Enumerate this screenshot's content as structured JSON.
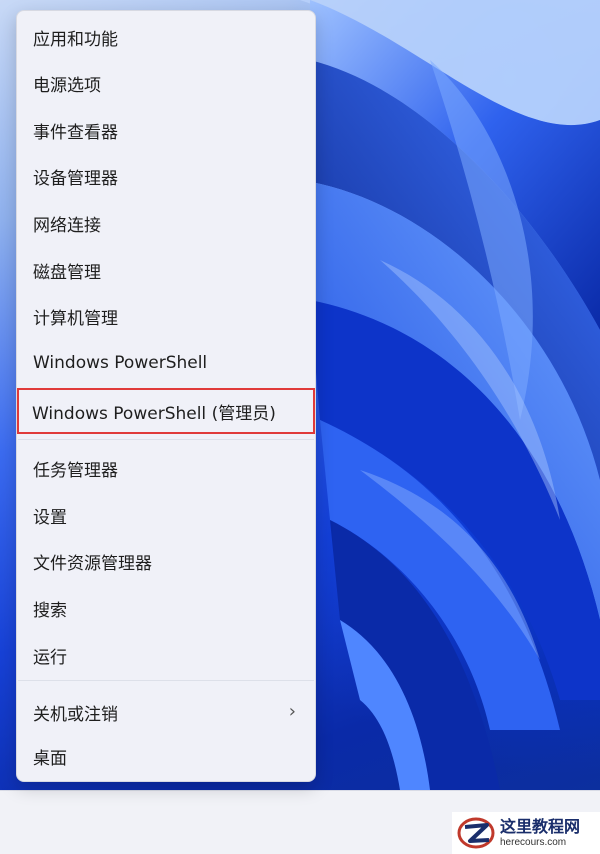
{
  "menu": {
    "items": [
      {
        "label": "应用和功能"
      },
      {
        "label": "电源选项"
      },
      {
        "label": "事件查看器"
      },
      {
        "label": "设备管理器"
      },
      {
        "label": "网络连接"
      },
      {
        "label": "磁盘管理"
      },
      {
        "label": "计算机管理"
      },
      {
        "label": "Windows PowerShell"
      },
      {
        "label": "Windows PowerShell (管理员)",
        "highlighted": true
      },
      {
        "label": "任务管理器"
      },
      {
        "label": "设置"
      },
      {
        "label": "文件资源管理器"
      },
      {
        "label": "搜索"
      },
      {
        "label": "运行"
      },
      {
        "label": "关机或注销",
        "has_submenu": true
      },
      {
        "label": "桌面"
      }
    ],
    "submenu_icon": "chevron-right-icon"
  },
  "watermark": {
    "title": "这里教程网",
    "url": "herecours.com",
    "logo_icon": "z-logo-icon"
  },
  "colors": {
    "highlight_border": "#e03a3a",
    "menu_background": "#f0f1f8",
    "wallpaper_blue": "#1741d6"
  }
}
